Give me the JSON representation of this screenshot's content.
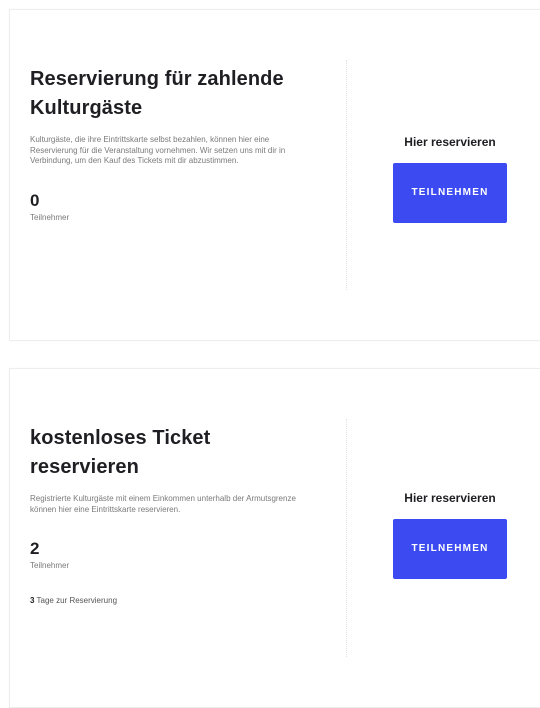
{
  "cards": [
    {
      "title": "Reservierung für zahlende Kulturgäste",
      "description": "Kulturgäste, die ihre Eintrittskarte selbst bezahlen, können hier eine Reservierung für die Veranstaltung vornehmen. Wir setzen uns mit dir in Verbindung, um den Kauf des Tickets mit dir abzustimmen.",
      "count": "0",
      "count_label": "Teilnehmer",
      "cta_title": "Hier reservieren",
      "button_label": "TEILNEHMEN"
    },
    {
      "title": "kostenloses Ticket reservieren",
      "description": "Registrierte Kulturgäste mit einem Einkommen unterhalb der Armutsgrenze können hier eine Eintrittskarte reservieren.",
      "count": "2",
      "count_label": "Teilnehmer",
      "days_number": "3",
      "days_text": "Tage zur Reservierung",
      "cta_title": "Hier reservieren",
      "button_label": "TEILNEHMEN"
    }
  ],
  "colors": {
    "button_bg": "#3c4bf1",
    "text_dark": "#1f1f23",
    "text_muted": "#7a7a7a"
  }
}
